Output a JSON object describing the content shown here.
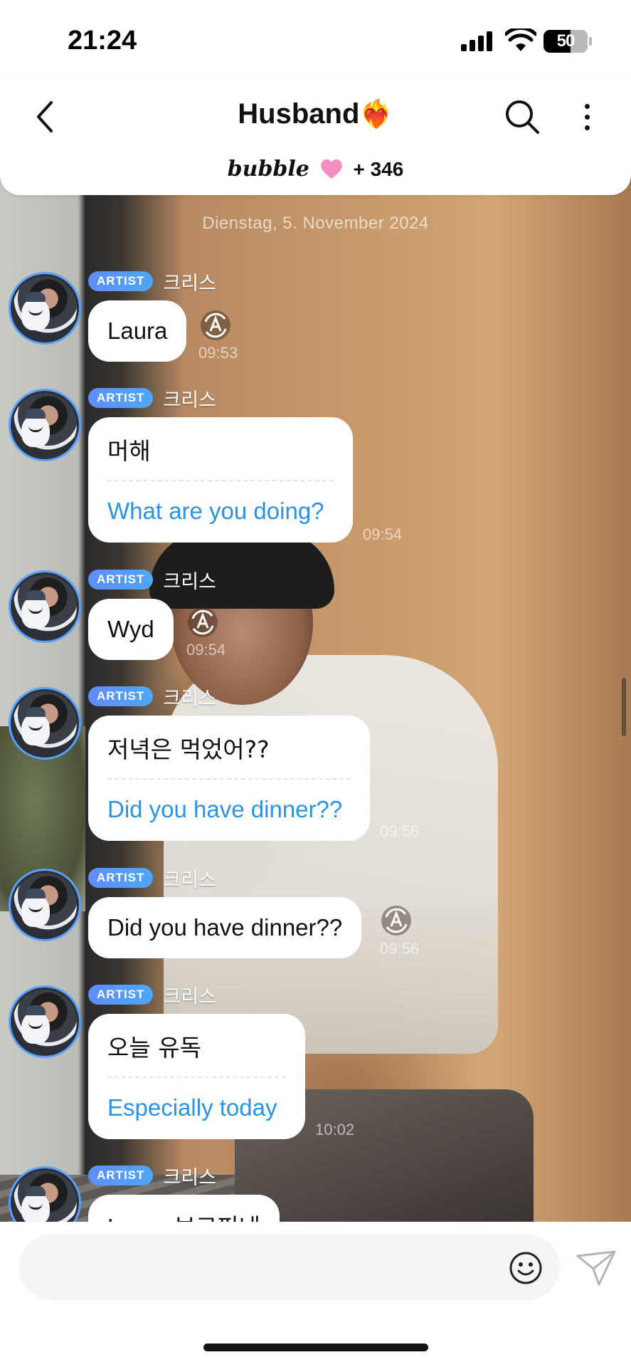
{
  "status_bar": {
    "time": "21:24",
    "battery": "50"
  },
  "header": {
    "title": "Husband",
    "title_emoji": "❤️‍🔥",
    "brand": "bubble",
    "subscriber_count": "+ 346"
  },
  "date_separator": "Dienstag, 5. November 2024",
  "messages": [
    {
      "badge": "ARTIST",
      "sender": "크리스",
      "text": "Laura",
      "time": "09:53"
    },
    {
      "badge": "ARTIST",
      "sender": "크리스",
      "text": "머해",
      "translation": "What are you doing?",
      "time": "09:54"
    },
    {
      "badge": "ARTIST",
      "sender": "크리스",
      "text": "Wyd",
      "time": "09:54"
    },
    {
      "badge": "ARTIST",
      "sender": "크리스",
      "text": "저녁은 먹었어??",
      "translation": "Did you have dinner??",
      "time": "09:56"
    },
    {
      "badge": "ARTIST",
      "sender": "크리스",
      "text": "Did you have dinner??",
      "time": "09:56"
    },
    {
      "badge": "ARTIST",
      "sender": "크리스",
      "text": "오늘 유독",
      "translation": "Especially today",
      "time": "10:02"
    },
    {
      "badge": "ARTIST",
      "sender": "크리스",
      "text": "Laura 보고피네"
    }
  ],
  "input": {
    "placeholder": ""
  },
  "colors": {
    "accent": "#4fa7f6",
    "translation_text": "#2a93e2",
    "badge_gradient_start": "#5e8dff"
  }
}
